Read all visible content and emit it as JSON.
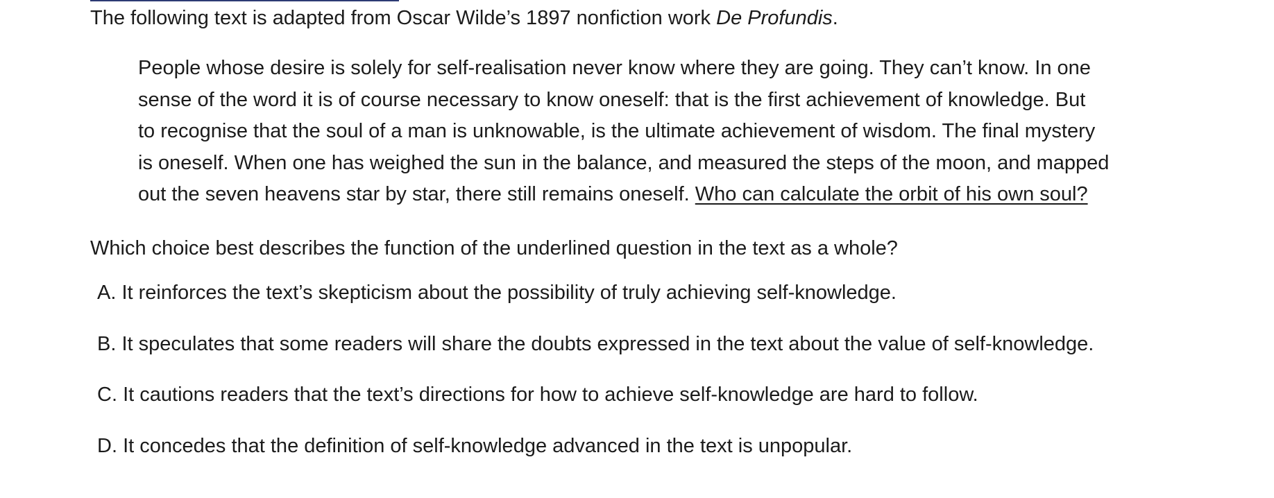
{
  "intro": {
    "before": "The following text is adapted from Oscar Wilde’s 1897 nonfiction work ",
    "work_title": "De Profundis",
    "after": "."
  },
  "passage": {
    "lines": [
      "People whose desire is solely for self-realisation never know where they are going. They can’t know. In one",
      "sense of the word it is of course necessary to know oneself: that is the first achievement of knowledge. But",
      "to recognise that the soul of a man is unknowable, is the ultimate achievement of wisdom. The final mystery",
      "is oneself. When one has weighed the sun in the balance, and measured the steps of the moon, and mapped"
    ],
    "last_line_plain": "out the seven heavens star by star, there still remains oneself. ",
    "underlined_question": "Who can calculate the orbit of his own soul?"
  },
  "question": {
    "text": "Which choice best describes the function of the underlined question in the text as a whole?"
  },
  "choices": [
    {
      "letter": "A",
      "text": "It reinforces the text’s skepticism about the possibility of truly achieving self-knowledge."
    },
    {
      "letter": "B",
      "text": "It speculates that some readers will share the doubts expressed in the text about the value of self-knowledge."
    },
    {
      "letter": "C",
      "text": "It cautions readers that the text’s directions for how to achieve self-knowledge are hard to follow."
    },
    {
      "letter": "D",
      "text": "It concedes that the definition of self-knowledge advanced in the text is unpopular."
    }
  ]
}
